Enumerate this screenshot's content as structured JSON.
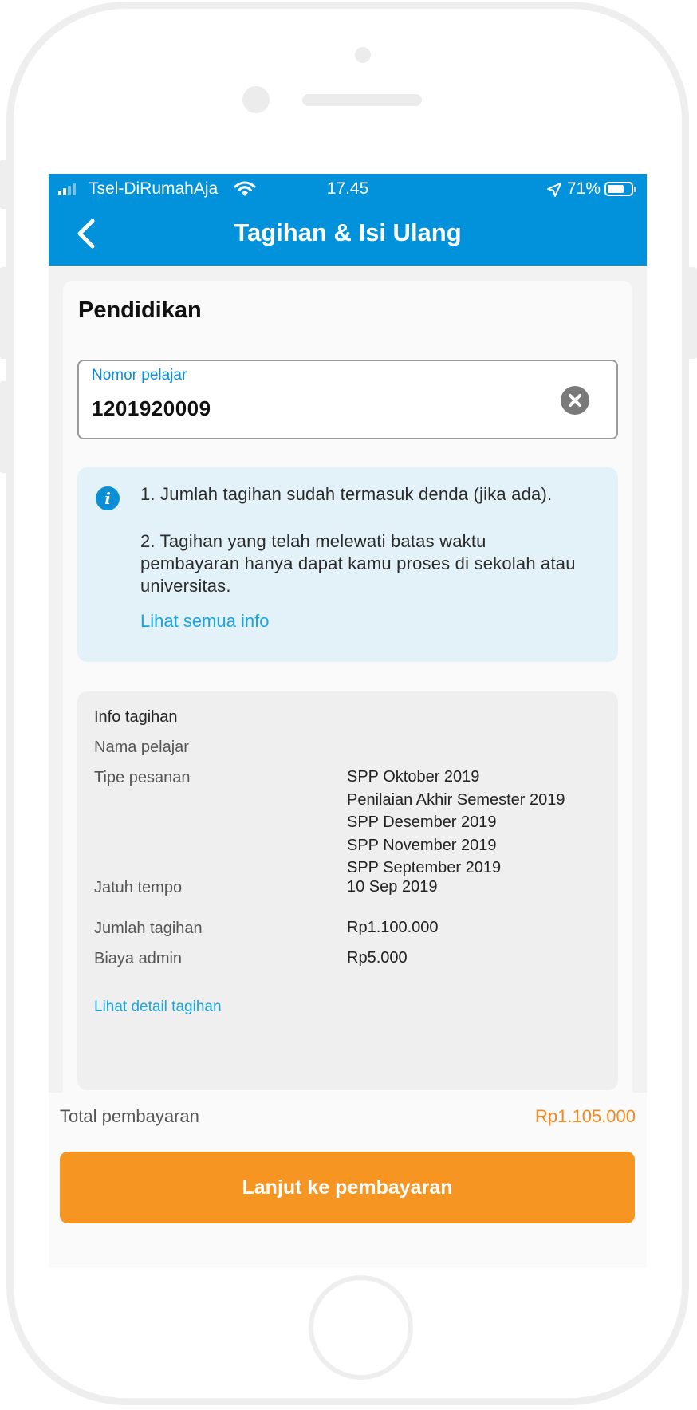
{
  "status_bar": {
    "carrier": "Tsel-DiRumahAja",
    "time": "17.45",
    "battery_percent": "71%",
    "battery_level": 0.71,
    "signal_bars": 2
  },
  "header": {
    "title": "Tagihan & Isi Ulang",
    "back_icon": "chevron-left-icon"
  },
  "section": {
    "title": "Pendidikan"
  },
  "student_field": {
    "label": "Nomor pelajar",
    "value": "1201920009",
    "clear_icon": "clear-icon"
  },
  "info": {
    "icon": "info-icon",
    "item_1": "1. Jumlah tagihan sudah termasuk denda (jika ada).",
    "item_2": "2. Tagihan yang telah melewati batas waktu pembayaran hanya dapat kamu proses di sekolah atau universitas.",
    "link": "Lihat semua info"
  },
  "bill": {
    "heading": "Info tagihan",
    "name_label": "Nama pelajar",
    "name_value": "",
    "order_type_label": "Tipe pesanan",
    "order_types": [
      "SPP Oktober 2019",
      "Penilaian Akhir Semester 2019",
      "SPP Desember 2019",
      "SPP November 2019",
      "SPP September 2019"
    ],
    "due_label": "Jatuh tempo",
    "due_value": "10 Sep 2019",
    "amount_label": "Jumlah tagihan",
    "amount_value": "Rp1.100.000",
    "admin_label": "Biaya admin",
    "admin_value": "Rp5.000",
    "detail_link": "Lihat detail tagihan"
  },
  "footer": {
    "total_label": "Total pembayaran",
    "total_value": "Rp1.105.000",
    "pay_button": "Lanjut ke pembayaran"
  },
  "colors": {
    "primary_blue": "#0192db",
    "accent_orange": "#f79523",
    "total_orange": "#f5891e",
    "link_blue": "#1aa4dd",
    "info_bg": "#e3f1f9"
  }
}
